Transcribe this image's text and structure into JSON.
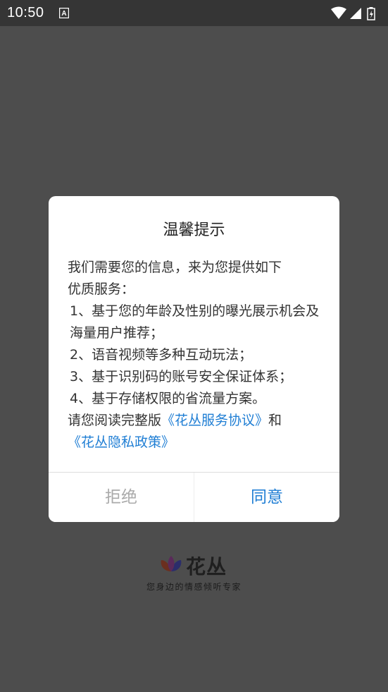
{
  "statusbar": {
    "time": "10:50",
    "notification_icon": "a-keyboard-icon",
    "icons": [
      "wifi-icon",
      "signal-icon",
      "battery-icon"
    ]
  },
  "splash": {
    "brand": "花丛",
    "tagline": "您身边的情感倾听专家",
    "logo_icon": "flower-logo-icon"
  },
  "dialog": {
    "title": "温馨提示",
    "intro_line1": "我们需要您的信息，来为您提供如下",
    "intro_line2": "优质服务：",
    "items": [
      "1、基于您的年龄及性别的曝光展示机会及海量用户推荐；",
      "2、语音视频等多种互动玩法；",
      "3、基于识别码的账号安全保证体系；",
      "4、基于存储权限的省流量方案。"
    ],
    "outro_prefix": "请您阅读完整版",
    "link_service": "《花丛服务协议》",
    "outro_and": "和",
    "link_privacy": "《花丛隐私政策》",
    "reject_label": "拒绝",
    "agree_label": "同意"
  },
  "colors": {
    "overlay": "#4d4d4d",
    "statusbar": "#353535",
    "link": "#1f7ed4",
    "reject": "#aaaaaa"
  }
}
